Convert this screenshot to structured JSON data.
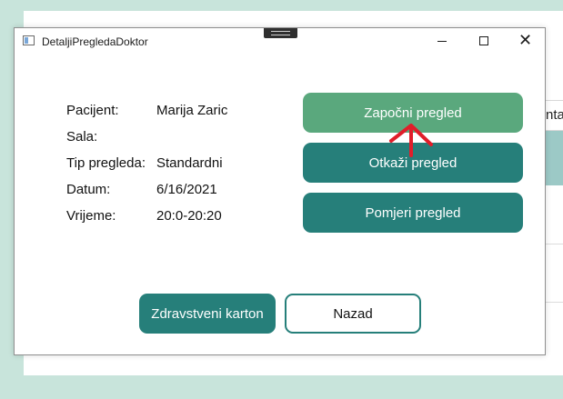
{
  "window": {
    "title": "DetaljiPregledaDoktor"
  },
  "background_app": {
    "tab_text": "ntal"
  },
  "details": {
    "patient_label": "Pacijent:",
    "patient_value": "Marija Zaric",
    "room_label": "Sala:",
    "room_value": "",
    "type_label": "Tip pregleda:",
    "type_value": "Standardni",
    "date_label": "Datum:",
    "date_value": "6/16/2021",
    "time_label": "Vrijeme:",
    "time_value": "20:0-20:20"
  },
  "actions": {
    "start_label": "Započni pregled",
    "cancel_label": "Otkaži pregled",
    "reschedule_label": "Pomjeri pregled"
  },
  "footer": {
    "record_label": "Zdravstveni karton",
    "back_label": "Nazad"
  },
  "colors": {
    "background": "#c8e4db",
    "primary": "#267f7a",
    "start_button": "#5aa87d",
    "annotation": "#e01e2a"
  },
  "icons": {
    "app": "app-window-icon",
    "minimize": "minimize-icon",
    "maximize": "maximize-icon",
    "close": "close-icon",
    "annotation": "red-arrow-icon"
  }
}
